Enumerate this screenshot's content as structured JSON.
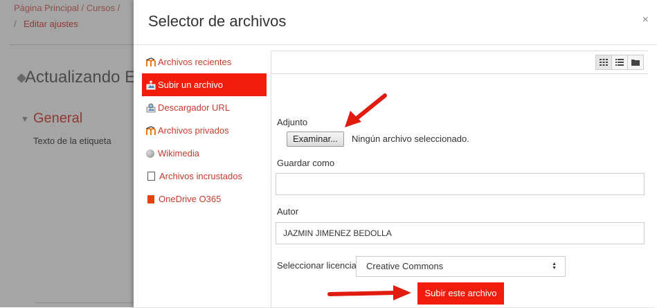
{
  "background": {
    "breadcrumb_top": "Página Principal / Cursos /",
    "breadcrumb_slash": "/",
    "breadcrumb_edit": "Editar ajustes",
    "page_title": "Actualizando E",
    "section_title": "General",
    "field_label": "Texto de la etiqueta"
  },
  "modal": {
    "title": "Selector de archivos",
    "close": "×"
  },
  "nav": {
    "items": [
      {
        "label": "Archivos recientes",
        "icon": "moodle-icon"
      },
      {
        "label": "Subir un archivo",
        "icon": "upload-icon",
        "active": true
      },
      {
        "label": "Descargador URL",
        "icon": "url-icon"
      },
      {
        "label": "Archivos privados",
        "icon": "moodle-icon"
      },
      {
        "label": "Wikimedia",
        "icon": "wikimedia-icon"
      },
      {
        "label": "Archivos incrustados",
        "icon": "document-icon"
      },
      {
        "label": "OneDrive O365",
        "icon": "office-icon"
      }
    ]
  },
  "form": {
    "attachment_label": "Adjunto",
    "browse_button": "Examinar...",
    "file_status": "Ningún archivo seleccionado.",
    "save_as_label": "Guardar como",
    "save_as_value": "",
    "author_label": "Autor",
    "author_value": "JAZMIN JIMENEZ BEDOLLA",
    "license_label": "Seleccionar licencia",
    "license_value": "Creative Commons",
    "submit_label": "Subir este archivo"
  },
  "colors": {
    "accent": "#f21c0d",
    "link": "#c73a2e"
  }
}
